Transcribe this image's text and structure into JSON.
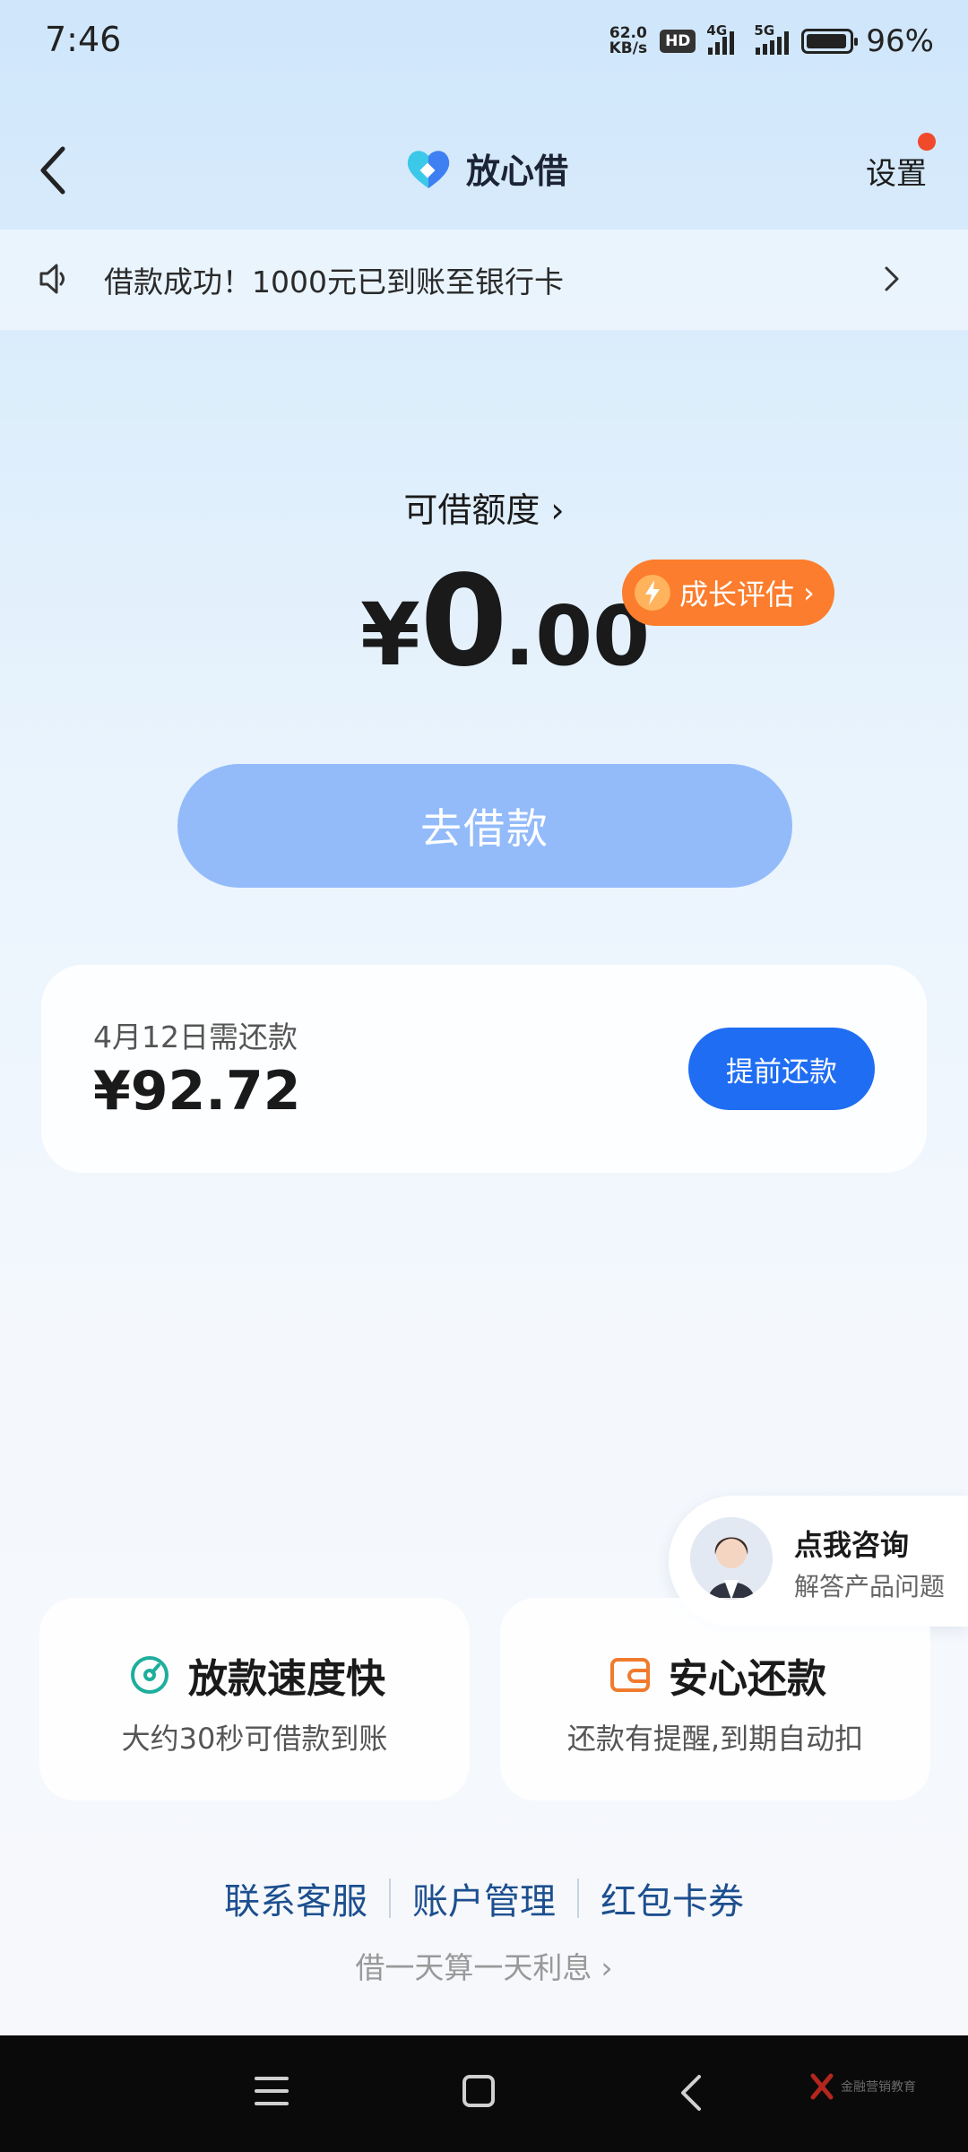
{
  "status_bar": {
    "time": "7:46",
    "net_speed_value": "62.0",
    "net_speed_unit": "KB/s",
    "hd_badge": "HD",
    "signal1_label": "4G",
    "signal2_label": "5G",
    "battery_level": 0.96,
    "battery_text": "96%"
  },
  "header": {
    "brand_name": "放心借",
    "settings_label": "设置",
    "brand_colors": {
      "left": "#3cc8e8",
      "right": "#3e7ff2"
    },
    "notification_dot_color": "#f04a2c"
  },
  "notice": {
    "text": "借款成功！1000元已到账至银行卡"
  },
  "limit": {
    "label": "可借额度",
    "chevron": "›",
    "currency": "¥",
    "integer": "0",
    "decimal": ".00",
    "growth_label": "成长评估"
  },
  "borrow": {
    "label": "去借款"
  },
  "repay": {
    "due_text": "4月12日需还款",
    "amount": "¥92.72",
    "prepay_label": "提前还款"
  },
  "consult": {
    "title": "点我咨询",
    "subtitle": "解答产品问题"
  },
  "features": [
    {
      "title": "放款速度快",
      "desc": "大约30秒可借款到账",
      "icon": "speed-icon",
      "color": "#1fae9c"
    },
    {
      "title": "安心还款",
      "desc": "还款有提醒,到期自动扣",
      "icon": "wallet-icon",
      "color": "#f07b2e"
    }
  ],
  "links": [
    "联系客服",
    "账户管理",
    "红包卡券"
  ],
  "daily_interest": "借一天算一天利息",
  "watermark": "金融营销教育",
  "colors": {
    "primary_blue": "#1f6df2",
    "borrow_button": "#93bbfa",
    "growth_orange": "#fb7d2d",
    "link_blue": "#1d4f8f"
  }
}
